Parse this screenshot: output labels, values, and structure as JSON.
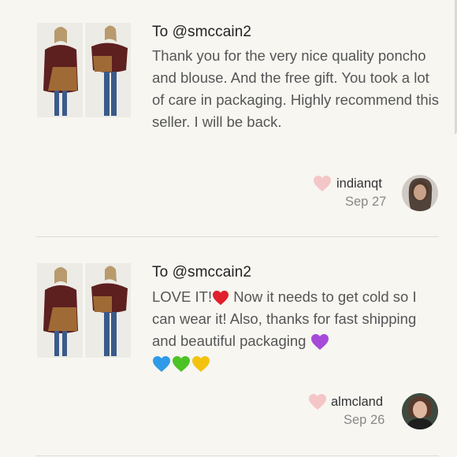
{
  "reviews": [
    {
      "to": "To @smccain2",
      "text": "Thank you for the very nice quality poncho and blouse. And the free gift. You took a lot of care in packaging. Highly recommend this seller. I will be back.",
      "username": "indianqt",
      "date": "Sep 27"
    },
    {
      "to": "To @smccain2",
      "text_part1": "LOVE IT!",
      "text_part2": " Now it needs to get cold so I can wear it! Also, thanks for fast shipping and beautiful packaging ",
      "username": "almcland",
      "date": "Sep 26"
    }
  ],
  "icons": {
    "like": "heart-icon",
    "red_heart": "red-heart-emoji",
    "purple_heart": "purple-heart-emoji",
    "blue_heart": "blue-heart-emoji",
    "green_heart": "green-heart-emoji",
    "yellow_heart": "yellow-heart-emoji"
  },
  "colors": {
    "background": "#f7f6f1",
    "like_heart": "#f5c6c8",
    "divider": "#dddcd5"
  }
}
